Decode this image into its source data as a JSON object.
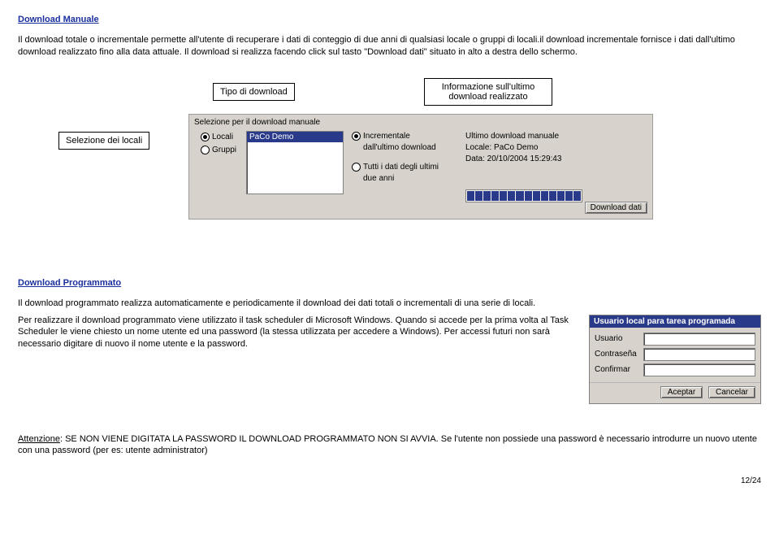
{
  "heading1": "Download Manuale",
  "p1": "Il download totale o incrementale permette all'utente di recuperare i dati di conteggio di due anni di qualsiasi locale o gruppi di locali.il download incrementale fornisce i dati dall'ultimo download realizzato fino alla data attuale. Il download si realizza facendo click sul tasto \"Download dati\" situato in alto a destra dello schermo.",
  "callouts": {
    "tipo": "Tipo di download",
    "info": "Informazione sull'ultimo download realizzato",
    "selez": "Selezione dei locali"
  },
  "panel": {
    "top": "Selezione per il download manuale",
    "r_locali": "Locali",
    "r_gruppi": "Gruppi",
    "r_incr1": "Incrementale",
    "r_incr2": "dall'ultimo download",
    "r_tutti1": "Tutti i dati degli ultimi",
    "r_tutti2": "due anni",
    "last_h": "Ultimo download manuale",
    "last_l": "Locale: PaCo Demo",
    "last_d": "Data: 20/10/2004 15:29:43",
    "listitem": "PaCo Demo",
    "btn": "Download dati"
  },
  "heading2": "Download Programmato",
  "p2": "Il download programmato realizza automaticamente e periodicamente il download dei dati totali o incrementali di una serie di locali.",
  "p3": "Per realizzare il download programmato viene utilizzato il task scheduler di Microsoft Windows. Quando si accede per la prima volta al Task Scheduler le viene chiesto un nome utente ed una password (la stessa utilizzata per accedere a Windows). Per accessi futuri non sarà necessario digitare di nuovo il nome utente e la password.",
  "login": {
    "title": "Usuario local para tarea programada",
    "user": "Usuario",
    "pass": "Contraseña",
    "conf": "Confirmar",
    "ok": "Aceptar",
    "cancel": "Cancelar"
  },
  "att_label": "Attenzione",
  "att_text": ": SE NON VIENE DIGITATA LA PASSWORD IL DOWNLOAD PROGRAMMATO NON SI AVVIA. Se l'utente non possiede una password è necessario introdurre un nuovo utente con una password (per es: utente administrator)",
  "pagenum": "12/24"
}
